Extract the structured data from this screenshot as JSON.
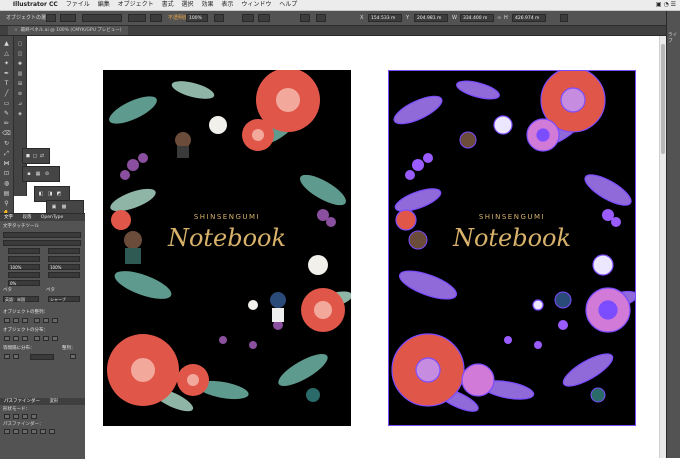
{
  "menubar": {
    "app_name": "Illustrator CC",
    "items": [
      "ファイル",
      "編集",
      "オブジェクト",
      "書式",
      "選択",
      "効果",
      "表示",
      "ウィンドウ",
      "ヘルプ"
    ]
  },
  "control_bar": {
    "selection_label": "オブジェクトの選択",
    "opacity_label": "不透明度",
    "opacity_value": "100%",
    "x_label": "X",
    "x_value": "154.533 m",
    "y_label": "Y",
    "y_value": "204.981 m",
    "w_label": "W",
    "w_value": "334.400 m",
    "h_label": "H",
    "h_value": "426.974 m"
  },
  "document_tab": {
    "label": "最終ペネル.ai @ 100% (CMYK/GPU プレビュー)"
  },
  "right_dock": {
    "label": "ライブ"
  },
  "char_panel": {
    "tabs": [
      "文字",
      "段落",
      "OpenType"
    ],
    "tool_label": "文字タッチツール",
    "font_size": "100%",
    "leading": "100%",
    "tracking": "0%",
    "kerning_label": "ペタ",
    "tracking_label": "ペタ",
    "language": "英語：米国",
    "aa": "シャープ"
  },
  "align_panel": {
    "title": "オブジェクトの整列：",
    "distribute_title": "オブジェクトの分布：",
    "spacing_title": "等間隔に分布：",
    "spacing_value": "整列："
  },
  "pathfinder_panel": {
    "tabs": [
      "パスファインダー",
      "変形"
    ],
    "shape_modes_label": "形状モード：",
    "pathfinders_label": "パスファインダー："
  },
  "artwork": {
    "brand": "SHINSENGUMI",
    "title": "Notebook",
    "colors": {
      "background": "#000000",
      "coral": "#e0574a",
      "pink": "#f2a99c",
      "teal": "#5e9a8e",
      "sage": "#8fb5a6",
      "purple": "#8a4f9e",
      "white_flower": "#f2f0ea",
      "gold": "#d8b26a",
      "selection_blue": "#7c4cff"
    }
  }
}
